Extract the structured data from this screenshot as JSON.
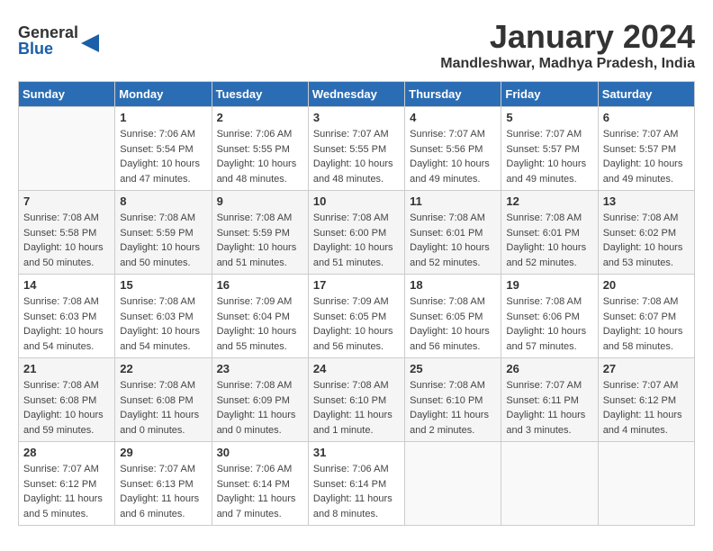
{
  "header": {
    "logo_general": "General",
    "logo_blue": "Blue",
    "month_year": "January 2024",
    "location": "Mandleshwar, Madhya Pradesh, India"
  },
  "days_of_week": [
    "Sunday",
    "Monday",
    "Tuesday",
    "Wednesday",
    "Thursday",
    "Friday",
    "Saturday"
  ],
  "weeks": [
    [
      {
        "day": "",
        "sunrise": "",
        "sunset": "",
        "daylight": ""
      },
      {
        "day": "1",
        "sunrise": "Sunrise: 7:06 AM",
        "sunset": "Sunset: 5:54 PM",
        "daylight": "Daylight: 10 hours and 47 minutes."
      },
      {
        "day": "2",
        "sunrise": "Sunrise: 7:06 AM",
        "sunset": "Sunset: 5:55 PM",
        "daylight": "Daylight: 10 hours and 48 minutes."
      },
      {
        "day": "3",
        "sunrise": "Sunrise: 7:07 AM",
        "sunset": "Sunset: 5:55 PM",
        "daylight": "Daylight: 10 hours and 48 minutes."
      },
      {
        "day": "4",
        "sunrise": "Sunrise: 7:07 AM",
        "sunset": "Sunset: 5:56 PM",
        "daylight": "Daylight: 10 hours and 49 minutes."
      },
      {
        "day": "5",
        "sunrise": "Sunrise: 7:07 AM",
        "sunset": "Sunset: 5:57 PM",
        "daylight": "Daylight: 10 hours and 49 minutes."
      },
      {
        "day": "6",
        "sunrise": "Sunrise: 7:07 AM",
        "sunset": "Sunset: 5:57 PM",
        "daylight": "Daylight: 10 hours and 49 minutes."
      }
    ],
    [
      {
        "day": "7",
        "sunrise": "Sunrise: 7:08 AM",
        "sunset": "Sunset: 5:58 PM",
        "daylight": "Daylight: 10 hours and 50 minutes."
      },
      {
        "day": "8",
        "sunrise": "Sunrise: 7:08 AM",
        "sunset": "Sunset: 5:59 PM",
        "daylight": "Daylight: 10 hours and 50 minutes."
      },
      {
        "day": "9",
        "sunrise": "Sunrise: 7:08 AM",
        "sunset": "Sunset: 5:59 PM",
        "daylight": "Daylight: 10 hours and 51 minutes."
      },
      {
        "day": "10",
        "sunrise": "Sunrise: 7:08 AM",
        "sunset": "Sunset: 6:00 PM",
        "daylight": "Daylight: 10 hours and 51 minutes."
      },
      {
        "day": "11",
        "sunrise": "Sunrise: 7:08 AM",
        "sunset": "Sunset: 6:01 PM",
        "daylight": "Daylight: 10 hours and 52 minutes."
      },
      {
        "day": "12",
        "sunrise": "Sunrise: 7:08 AM",
        "sunset": "Sunset: 6:01 PM",
        "daylight": "Daylight: 10 hours and 52 minutes."
      },
      {
        "day": "13",
        "sunrise": "Sunrise: 7:08 AM",
        "sunset": "Sunset: 6:02 PM",
        "daylight": "Daylight: 10 hours and 53 minutes."
      }
    ],
    [
      {
        "day": "14",
        "sunrise": "Sunrise: 7:08 AM",
        "sunset": "Sunset: 6:03 PM",
        "daylight": "Daylight: 10 hours and 54 minutes."
      },
      {
        "day": "15",
        "sunrise": "Sunrise: 7:08 AM",
        "sunset": "Sunset: 6:03 PM",
        "daylight": "Daylight: 10 hours and 54 minutes."
      },
      {
        "day": "16",
        "sunrise": "Sunrise: 7:09 AM",
        "sunset": "Sunset: 6:04 PM",
        "daylight": "Daylight: 10 hours and 55 minutes."
      },
      {
        "day": "17",
        "sunrise": "Sunrise: 7:09 AM",
        "sunset": "Sunset: 6:05 PM",
        "daylight": "Daylight: 10 hours and 56 minutes."
      },
      {
        "day": "18",
        "sunrise": "Sunrise: 7:08 AM",
        "sunset": "Sunset: 6:05 PM",
        "daylight": "Daylight: 10 hours and 56 minutes."
      },
      {
        "day": "19",
        "sunrise": "Sunrise: 7:08 AM",
        "sunset": "Sunset: 6:06 PM",
        "daylight": "Daylight: 10 hours and 57 minutes."
      },
      {
        "day": "20",
        "sunrise": "Sunrise: 7:08 AM",
        "sunset": "Sunset: 6:07 PM",
        "daylight": "Daylight: 10 hours and 58 minutes."
      }
    ],
    [
      {
        "day": "21",
        "sunrise": "Sunrise: 7:08 AM",
        "sunset": "Sunset: 6:08 PM",
        "daylight": "Daylight: 10 hours and 59 minutes."
      },
      {
        "day": "22",
        "sunrise": "Sunrise: 7:08 AM",
        "sunset": "Sunset: 6:08 PM",
        "daylight": "Daylight: 11 hours and 0 minutes."
      },
      {
        "day": "23",
        "sunrise": "Sunrise: 7:08 AM",
        "sunset": "Sunset: 6:09 PM",
        "daylight": "Daylight: 11 hours and 0 minutes."
      },
      {
        "day": "24",
        "sunrise": "Sunrise: 7:08 AM",
        "sunset": "Sunset: 6:10 PM",
        "daylight": "Daylight: 11 hours and 1 minute."
      },
      {
        "day": "25",
        "sunrise": "Sunrise: 7:08 AM",
        "sunset": "Sunset: 6:10 PM",
        "daylight": "Daylight: 11 hours and 2 minutes."
      },
      {
        "day": "26",
        "sunrise": "Sunrise: 7:07 AM",
        "sunset": "Sunset: 6:11 PM",
        "daylight": "Daylight: 11 hours and 3 minutes."
      },
      {
        "day": "27",
        "sunrise": "Sunrise: 7:07 AM",
        "sunset": "Sunset: 6:12 PM",
        "daylight": "Daylight: 11 hours and 4 minutes."
      }
    ],
    [
      {
        "day": "28",
        "sunrise": "Sunrise: 7:07 AM",
        "sunset": "Sunset: 6:12 PM",
        "daylight": "Daylight: 11 hours and 5 minutes."
      },
      {
        "day": "29",
        "sunrise": "Sunrise: 7:07 AM",
        "sunset": "Sunset: 6:13 PM",
        "daylight": "Daylight: 11 hours and 6 minutes."
      },
      {
        "day": "30",
        "sunrise": "Sunrise: 7:06 AM",
        "sunset": "Sunset: 6:14 PM",
        "daylight": "Daylight: 11 hours and 7 minutes."
      },
      {
        "day": "31",
        "sunrise": "Sunrise: 7:06 AM",
        "sunset": "Sunset: 6:14 PM",
        "daylight": "Daylight: 11 hours and 8 minutes."
      },
      {
        "day": "",
        "sunrise": "",
        "sunset": "",
        "daylight": ""
      },
      {
        "day": "",
        "sunrise": "",
        "sunset": "",
        "daylight": ""
      },
      {
        "day": "",
        "sunrise": "",
        "sunset": "",
        "daylight": ""
      }
    ]
  ]
}
